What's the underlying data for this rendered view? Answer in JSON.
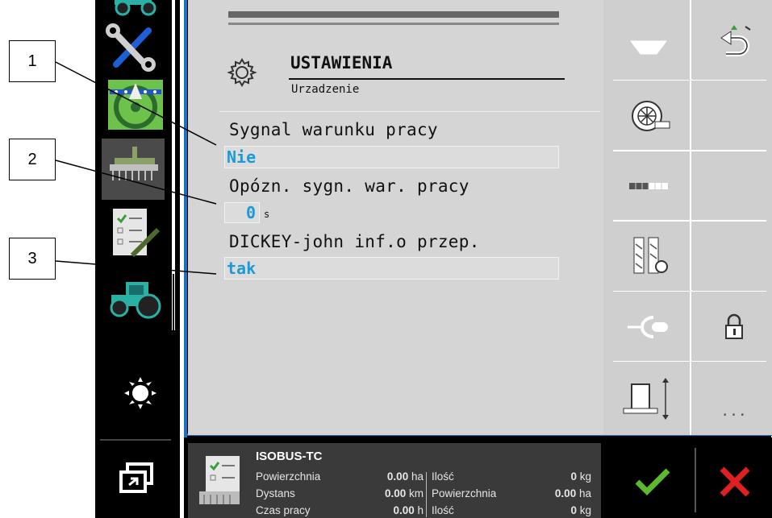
{
  "callouts": [
    "1",
    "2",
    "3"
  ],
  "header": {
    "title": "USTAWIENIA",
    "subtitle": "Urzadzenie"
  },
  "fields": [
    {
      "label": "Sygnal warunku pracy",
      "value": "Nie"
    },
    {
      "label": "Opózn. sygn. war. pracy",
      "value": "0",
      "unit": "s"
    },
    {
      "label": "DICKEY-john inf.o przep.",
      "value": "tak"
    }
  ],
  "softkeys_left": [
    "hopper-icon",
    "fan-icon",
    "section-bar-icon",
    "row-sensor-settings-icon",
    "hitch-icon",
    "implement-lift-icon"
  ],
  "softkeys_right": [
    "back-icon",
    "",
    "",
    "",
    "lock-icon",
    "more-icon"
  ],
  "more_label": "...",
  "taskcontroller": {
    "title": "ISOBUS-TC",
    "rows": [
      {
        "l1": "Powierzchnia",
        "v1": "0.00",
        "u1": "ha",
        "l2": "Ilość",
        "v2": "0",
        "u2": "kg"
      },
      {
        "l1": "Dystans",
        "v1": "0.00",
        "u1": "km",
        "l2": "Powierzchnia",
        "v2": "0.00",
        "u2": "ha"
      },
      {
        "l1": "Czas pracy",
        "v1": "0.00",
        "u1": "h",
        "l2": "Ilość",
        "v2": "0",
        "u2": "kg"
      }
    ]
  },
  "colors": {
    "accent": "#1a9ad6",
    "confirm": "#5cb82e",
    "cancel": "#e02020"
  }
}
